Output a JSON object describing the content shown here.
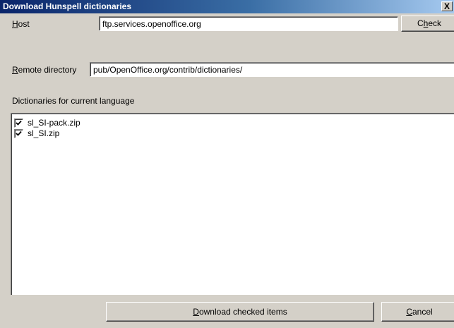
{
  "window": {
    "title": "Download Hunspell dictionaries",
    "close_glyph": "X"
  },
  "host": {
    "label_accel": "H",
    "label_rest": "ost",
    "value": "ftp.services.openoffice.org"
  },
  "check_button": {
    "label_pre": "C",
    "label_accel": "h",
    "label_post": "eck"
  },
  "remote_directory": {
    "label_accel": "R",
    "label_rest": "emote directory",
    "value": "pub/OpenOffice.org/contrib/dictionaries/"
  },
  "dictionaries": {
    "heading": "Dictionaries for current language",
    "items": [
      {
        "label": "sl_SI-pack.zip",
        "checked": true
      },
      {
        "label": "sl_SI.zip",
        "checked": true
      }
    ]
  },
  "download_button": {
    "label_accel": "D",
    "label_rest": "ownload checked items"
  },
  "cancel_button": {
    "label_accel": "C",
    "label_rest": "ancel"
  },
  "icons": {
    "close": "close-icon",
    "check": "checkmark-icon"
  },
  "colors": {
    "titlebar_start": "#0a246a",
    "titlebar_end": "#a6caf0",
    "dialog_face": "#d4d0c8"
  }
}
